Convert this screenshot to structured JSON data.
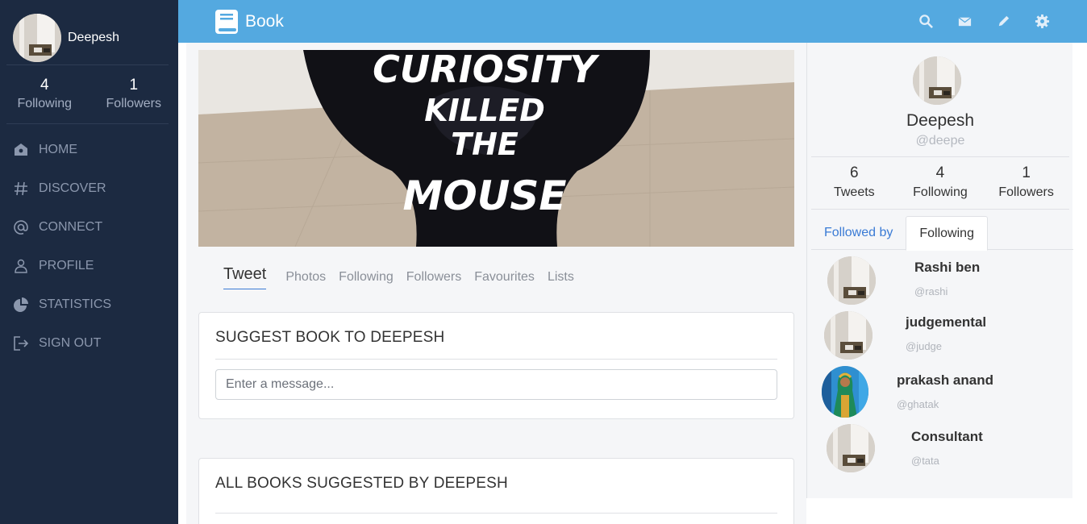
{
  "sidebar": {
    "user_name": "Deepesh",
    "stats": [
      {
        "value": "4",
        "label": "Following"
      },
      {
        "value": "1",
        "label": "Followers"
      }
    ],
    "nav": [
      {
        "label": "HOME",
        "icon": "home-icon"
      },
      {
        "label": "DISCOVER",
        "icon": "hashtag-icon"
      },
      {
        "label": "CONNECT",
        "icon": "at-icon"
      },
      {
        "label": "PROFILE",
        "icon": "user-icon"
      },
      {
        "label": "STATISTICS",
        "icon": "pie-chart-icon"
      },
      {
        "label": "SIGN OUT",
        "icon": "sign-out-icon"
      }
    ]
  },
  "topbar": {
    "brand": "Book",
    "icons": [
      "search-icon",
      "envelope-icon",
      "pencil-icon",
      "gear-icon"
    ]
  },
  "main": {
    "cover_text": [
      "CURIOSITY",
      "KILLED",
      "THE",
      "MOUSE"
    ],
    "tabs": [
      "Tweet",
      "Photos",
      "Following",
      "Followers",
      "Favourites",
      "Lists"
    ],
    "suggest_card": {
      "title": "SUGGEST BOOK TO DEEPESH",
      "input_placeholder": "Enter a message..."
    },
    "all_books_card": {
      "title": "ALL BOOKS SUGGESTED BY DEEPESH"
    }
  },
  "profile_panel": {
    "name": "Deepesh",
    "handle": "@deepe",
    "stats": [
      {
        "value": "6",
        "label": "Tweets"
      },
      {
        "value": "4",
        "label": "Following"
      },
      {
        "value": "1",
        "label": "Followers"
      }
    ],
    "tabs": [
      "Followed by",
      "Following"
    ],
    "list": [
      {
        "name": "Rashi ben",
        "handle": "@rashi"
      },
      {
        "name": "judgemental",
        "handle": "@judge"
      },
      {
        "name": "prakash anand",
        "handle": "@ghatak"
      },
      {
        "name": "Consultant",
        "handle": "@tata"
      }
    ]
  },
  "colors": {
    "sidebar_bg": "#1c2a41",
    "topbar_bg": "#54a9e0",
    "link_blue": "#3a7bd5",
    "page_bg": "#f5f6f8"
  }
}
